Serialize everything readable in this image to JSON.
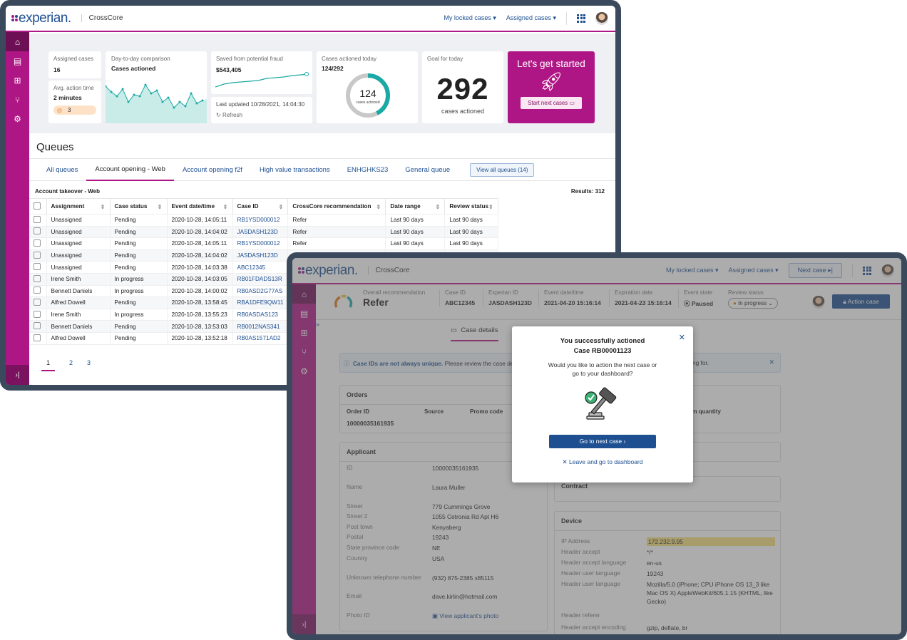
{
  "dashboard": {
    "brand": "CrossCore",
    "logo_text": "experian.",
    "nav": {
      "locked": "My locked cases",
      "assigned": "Assigned cases"
    },
    "cards": {
      "assigned_label": "Assigned cases",
      "assigned_value": "16",
      "avg_label": "Avg. action time",
      "avg_value": "2 minutes",
      "badge_value": "3",
      "d2d_label": "Day-to-day comparison",
      "d2d_value": "Cases actioned",
      "saved_label": "Saved from potential fraud",
      "saved_value": "$543,405",
      "updated": "Last updated 10/28/2021, 14:04:30",
      "refresh": "Refresh",
      "actioned_label": "Cases actioned today",
      "actioned_value": "124/292",
      "donut_value": "124",
      "donut_label": "cases actioned",
      "donut_fraction": 0.4247,
      "goal_label": "Goal for today",
      "goal_value": "292",
      "goal_sub": "cases actioned",
      "cta_title": "Let's get started",
      "cta_button": "Start next cases"
    },
    "queues_title": "Queues",
    "tabs": [
      "All queues",
      "Account opening - Web",
      "Account opening f2f",
      "High value transactions",
      "ENHGHKS23",
      "General queue"
    ],
    "view_all": "View all queues (14)",
    "table_title": "Account takeover - Web",
    "results": "Results: 312",
    "columns": [
      "Assignment",
      "Case status",
      "Event date/time",
      "Case ID",
      "CrossCore recommendation",
      "Date range",
      "Review status"
    ],
    "rows": [
      [
        "Unassigned",
        "Pending",
        "2020-10-28, 14:05:11",
        "RB1YSD000012",
        "Refer",
        "Last 90 days",
        "Last 90 days"
      ],
      [
        "Unassigned",
        "Pending",
        "2020-10-28, 14:04:02",
        "JASDASH123D",
        "Refer",
        "Last 90 days",
        "Last 90 days"
      ],
      [
        "Unassigned",
        "Pending",
        "2020-10-28, 14:05:11",
        "RB1YSD000012",
        "Refer",
        "Last 90 days",
        "Last 90 days"
      ],
      [
        "Unassigned",
        "Pending",
        "2020-10-28, 14:04:02",
        "JASDASH123D",
        "Refer",
        "Last 90 days",
        "Last 90 days"
      ],
      [
        "Unassigned",
        "Pending",
        "2020-10-28, 14:03:38",
        "ABC12345",
        "",
        "",
        ""
      ],
      [
        "Irene Smith",
        "In progress",
        "2020-10-28, 14:03:05",
        "RB01FDADS13R",
        "",
        "",
        ""
      ],
      [
        "Bennett Daniels",
        "In progress",
        "2020-10-28, 14:00:02",
        "RB0ASD2G77AS",
        "",
        "",
        ""
      ],
      [
        "Alfred Dowell",
        "Pending",
        "2020-10-28, 13:58:45",
        "RBA1DFE9QW11",
        "",
        "",
        ""
      ],
      [
        "Irene Smith",
        "In progress",
        "2020-10-28, 13:55:23",
        "RB0ASDAS123",
        "",
        "",
        ""
      ],
      [
        "Bennett Daniels",
        "Pending",
        "2020-10-28, 13:53:03",
        "RB0012NAS341",
        "",
        "",
        ""
      ],
      [
        "Alfred Dowell",
        "Pending",
        "2020-10-28, 13:52:18",
        "RB0AS1571AD2",
        "",
        "",
        ""
      ]
    ],
    "pages": [
      "1",
      "2",
      "3"
    ]
  },
  "case": {
    "brand": "CrossCore",
    "logo_text": "experian.",
    "nav": {
      "locked": "My locked cases",
      "assigned": "Assigned cases",
      "next": "Next case"
    },
    "overall_label": "Overall recommendation",
    "overall_value": "Refer",
    "fields": [
      {
        "label": "Case ID",
        "value": "ABC12345"
      },
      {
        "label": "Experian ID",
        "value": "JASDASH123D"
      },
      {
        "label": "Event date/time",
        "value": "2021-04-20 15:16:14"
      },
      {
        "label": "Expiration date",
        "value": "2021-04-23 15:16:14"
      },
      {
        "label": "Event state",
        "value": "Paused"
      }
    ],
    "review_label": "Review status",
    "review_value": "In progress",
    "action_button": "Action case",
    "tab_details": "Case details",
    "notice_bold": "Case IDs are not always unique.",
    "notice_text": "Please review the case de",
    "notice_tail": "arching for.",
    "orders_title": "Orders",
    "orders_cols": [
      "Order ID",
      "Source",
      "Promo code"
    ],
    "orders_right_col": "em quantity",
    "order_id": "10000035161935",
    "applicant_title": "Applicant",
    "applicant": [
      [
        "ID",
        "10000035161935"
      ],
      [
        "Name",
        "Laura Muller"
      ],
      [
        "Street",
        "779 Cummings Grove"
      ],
      [
        "Street 2",
        "1055 Cetronia Rd Apt H6"
      ],
      [
        "Post town",
        "Kenyaberg"
      ],
      [
        "Postal",
        "19243"
      ],
      [
        "State province code",
        "NE"
      ],
      [
        "Country",
        "USA"
      ],
      [
        "Unknown telephone number",
        "(932) 875-2385 x85115"
      ],
      [
        "Email",
        "dave.kirlin@hotmail.com"
      ],
      [
        "Photo ID",
        "View applicant's photo"
      ]
    ],
    "contract_title": "Contract",
    "device_title": "Device",
    "device": [
      [
        "IP Address",
        "172.232.9.95"
      ],
      [
        "Header accept",
        "*/*"
      ],
      [
        "Header accept language",
        "en-us"
      ],
      [
        "Header user language",
        "19243"
      ],
      [
        "Header user language",
        "Mozilla/5.0 (iPhone; CPU iPhone OS 13_3 like Mac OS X) AppleWebKit/605.1.15 (KHTML, like Gecko)"
      ],
      [
        "Header referer",
        ""
      ],
      [
        "Header accept encoding",
        "gzip, deflate, br"
      ]
    ],
    "modal": {
      "title": "You successfully actioned",
      "case": "Case RB00001123",
      "text": "Would you like to action the next case or go to your dashboard?",
      "primary": "Go to next case",
      "secondary": "Leave and go to dashboard"
    }
  },
  "colors": {
    "brand_magenta": "#af1685",
    "brand_blue": "#1d4f91",
    "teal": "#1aa9a4",
    "frame": "#3a4a5c"
  }
}
